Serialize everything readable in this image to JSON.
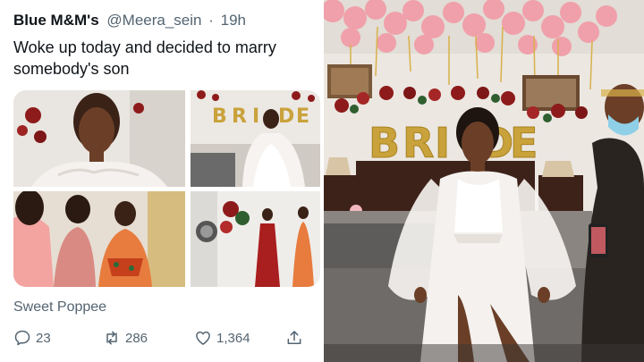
{
  "tweet": {
    "display_name": "Blue M&M's",
    "handle": "@Meera_sein",
    "separator": "·",
    "time": "19h",
    "text_line1": "Woke up today and decided to marry",
    "text_line2": "somebody's son",
    "quoted_author": "Sweet Poppee",
    "reply_count": "23",
    "retweet_count": "286",
    "like_count": "1,364"
  },
  "photo": {
    "balloon_letters": [
      "B",
      "R",
      "I",
      "D",
      "E"
    ],
    "thumb_letters": [
      "B",
      "R",
      "I",
      "D",
      "E"
    ]
  },
  "icons": {
    "reply": "reply-icon",
    "retweet": "retweet-icon",
    "like": "heart-icon",
    "share": "share-icon"
  },
  "colors": {
    "text": "#0f1419",
    "muted": "#536471",
    "balloon_pink": "#f0a0aa",
    "gold": "#c9a23b",
    "dress_white": "#f4f1ee",
    "orange_dress": "#e77c3e"
  }
}
